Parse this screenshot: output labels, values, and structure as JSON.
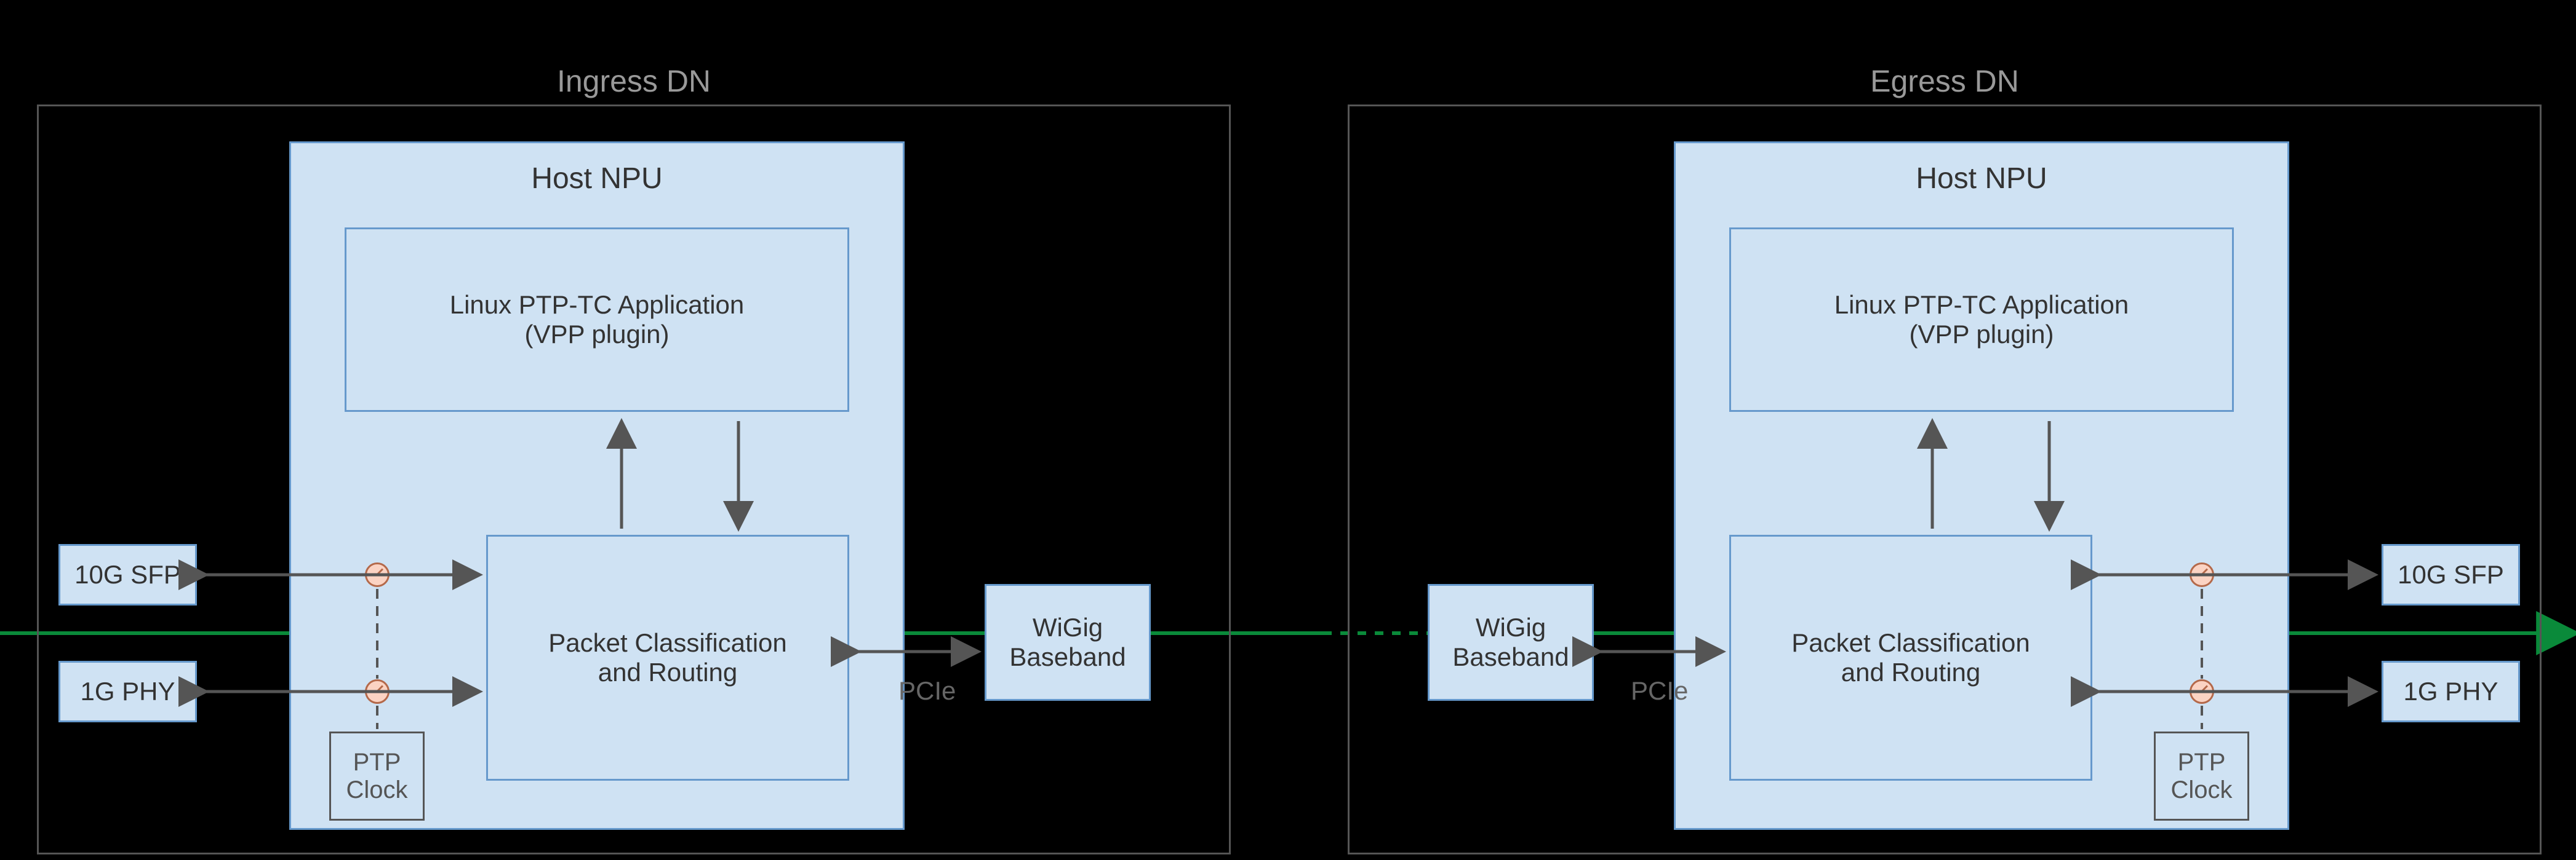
{
  "title_left": "Ingress DN",
  "title_right": "Egress DN",
  "host_npu": "Host NPU",
  "app_line1": "Linux PTP-TC Application",
  "app_line2": "(VPP plugin)",
  "pcr_line1": "Packet Classification",
  "pcr_line2": "and Routing",
  "wigig_line1": "WiGig",
  "wigig_line2": "Baseband",
  "pcie": "PCIe",
  "ptp_line1": "PTP",
  "ptp_line2": "Clock",
  "ten_g": "10G SFP",
  "one_g": "1G PHY"
}
